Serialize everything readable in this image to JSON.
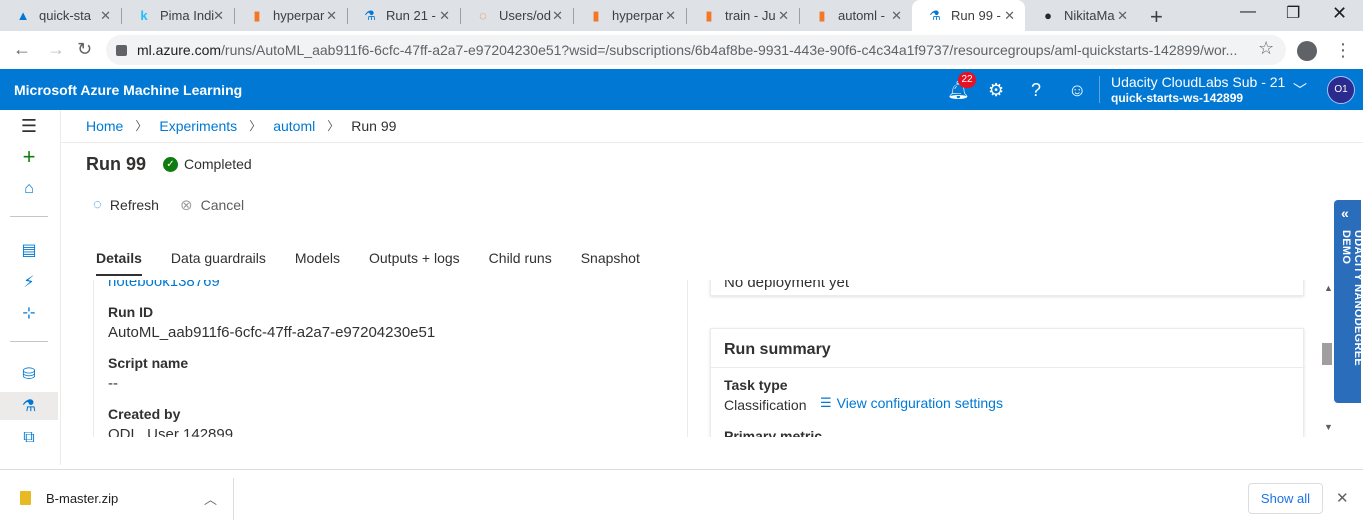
{
  "browser": {
    "tabs": [
      {
        "title": "quick-sta",
        "icon": "azure-ml-icon"
      },
      {
        "title": "Pima Indi",
        "icon": "kaggle-icon"
      },
      {
        "title": "hyperpar",
        "icon": "notebook-icon"
      },
      {
        "title": "Run 21 -",
        "icon": "flask-icon"
      },
      {
        "title": "Users/od",
        "icon": "loading-icon"
      },
      {
        "title": "hyperpar",
        "icon": "notebook-icon"
      },
      {
        "title": "train - Ju",
        "icon": "notebook-icon"
      },
      {
        "title": "automl -",
        "icon": "notebook-icon"
      },
      {
        "title": "Run 99 -",
        "icon": "flask-icon",
        "active": true
      },
      {
        "title": "NikitaMa",
        "icon": "github-icon"
      }
    ],
    "url_main": "ml.azure.com",
    "url_rest": "/runs/AutoML_aab911f6-6cfc-47ff-a2a7-e97204230e51?wsid=/subscriptions/6b4af8be-9931-443e-90f6-c4c34a1f9737/resourcegroups/aml-quickstarts-142899/wor..."
  },
  "header": {
    "brand": "Microsoft Azure Machine Learning",
    "notification_count": "22",
    "account_name": "Udacity CloudLabs Sub - 21",
    "workspace": "quick-starts-ws-142899",
    "avatar_initials": "O1",
    "color": "#0078d4"
  },
  "breadcrumb": {
    "items": [
      "Home",
      "Experiments",
      "automl"
    ],
    "current": "Run 99"
  },
  "run": {
    "title": "Run 99",
    "status": "Completed",
    "status_color": "#107c10"
  },
  "commands": {
    "refresh": "Refresh",
    "cancel": "Cancel"
  },
  "tabs": [
    "Details",
    "Data guardrails",
    "Models",
    "Outputs + logs",
    "Child runs",
    "Snapshot"
  ],
  "details": {
    "notebook_link": "notebook138769",
    "run_id_label": "Run ID",
    "run_id_value": "AutoML_aab911f6-6cfc-47ff-a2a7-e97204230e51",
    "script_name_label": "Script name",
    "script_name_value": "--",
    "created_by_label": "Created by",
    "created_by_value": "ODL_User 142899"
  },
  "right": {
    "deployment_text": "No deployment yet",
    "summary_title": "Run summary",
    "task_type_label": "Task type",
    "task_type_value": "Classification",
    "config_link": "View configuration settings",
    "primary_metric_label": "Primary metric"
  },
  "promo": {
    "text": "UDACITY NANODEGREE DEMO"
  },
  "download": {
    "file": "B-master.zip",
    "show_all": "Show all"
  }
}
